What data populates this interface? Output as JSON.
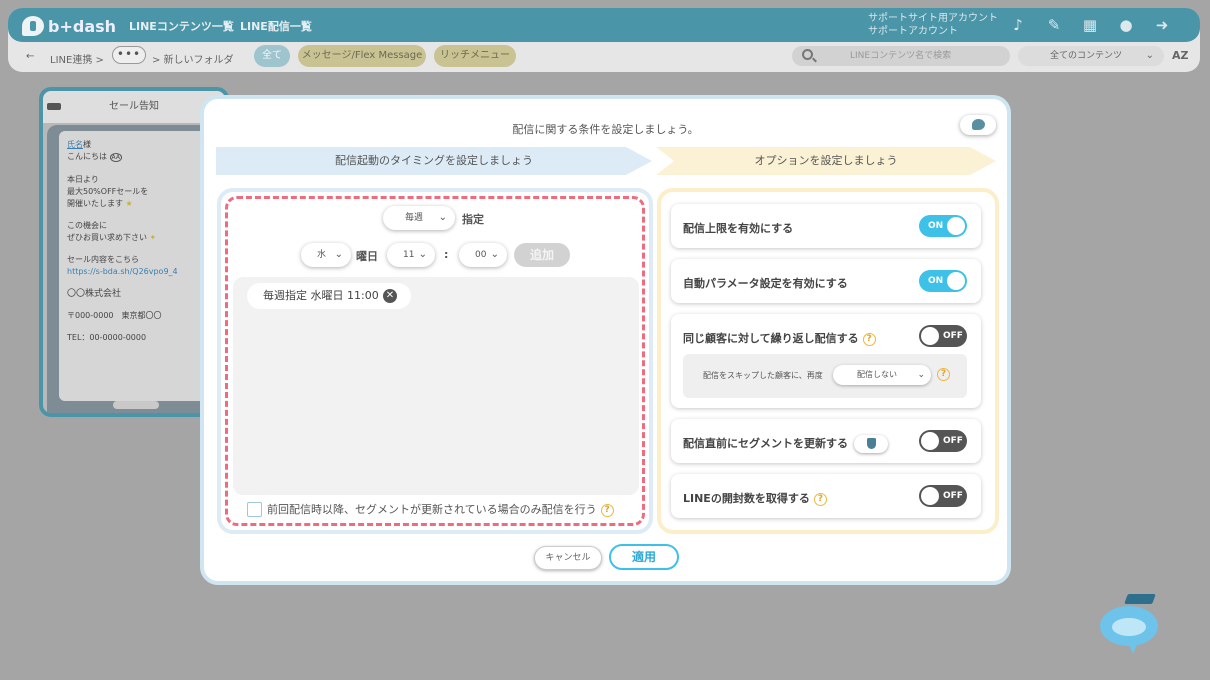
{
  "header": {
    "logo_text": "b+dash",
    "nav": [
      "LINEコンテンツ一覧",
      "LINE配信一覧"
    ],
    "support_lines": [
      "サポートサイト用アカウント",
      "サポートアカウント"
    ],
    "icons": [
      "bell-icon",
      "wrench-icon",
      "grid-icon",
      "chat-icon",
      "logout-icon"
    ]
  },
  "subbar": {
    "back": "←",
    "breadcrumb_root": "LINE連携 >",
    "breadcrumb_more": "•••",
    "breadcrumb_leaf": "> 新しいフォルダ",
    "filters": [
      "全て",
      "メッセージ/Flex Message",
      "リッチメニュー"
    ],
    "search_placeholder": "LINEコンテンツ名で検索",
    "content_select": "全てのコンテンツ",
    "sort_label": "AZ"
  },
  "preview": {
    "title": "セール告知",
    "lines": {
      "name": "氏名",
      "name_suffix": "様",
      "greeting": "こんにちは",
      "greeting_badge": "AA",
      "p2_1": "本日より",
      "p2_2": "最大50%OFFセールを",
      "p2_3": "開催いたします",
      "p3_1": "この機会に",
      "p3_2": "ぜひお買い求め下さい",
      "p4_1": "セール内容をこちら",
      "url": "https://s-bda.sh/Q26vpo9_4",
      "company": "〇〇株式会社",
      "address": "〒000-0000　東京都〇〇",
      "tel": "TEL：00-0000-0000"
    }
  },
  "modal": {
    "title": "配信に関する条件を設定しましょう。",
    "step1": "配信起動のタイミングを設定しましょう",
    "step2": "オプションを設定しましょう",
    "timing": {
      "frequency": "毎週",
      "frequency_suffix": "指定",
      "weekday": "水",
      "weekday_suffix": "曜日",
      "hour": "11",
      "colon": ":",
      "minute": "00",
      "add_label": "追加",
      "schedule_chip": "毎週指定 水曜日 11:00",
      "remove_glyph": "✕",
      "checkbox_label": "前回配信時以降、セグメントが更新されている場合のみ配信を行う"
    },
    "options": [
      {
        "label": "配信上限を有効にする",
        "state": "ON"
      },
      {
        "label": "自動パラメータ設定を有効にする",
        "state": "ON"
      },
      {
        "label": "同じ顧客に対して繰り返し配信する",
        "state": "OFF"
      },
      {
        "label": "配信直前にセグメントを更新する",
        "state": "OFF"
      },
      {
        "label": "LINEの開封数を取得する",
        "state": "OFF"
      }
    ],
    "repeat_sub": {
      "text": "配信をスキップした顧客に、再度",
      "select": "配信しない"
    },
    "help_glyph": "?",
    "cancel_label": "キャンセル",
    "apply_label": "適用"
  },
  "colors": {
    "accent": "#3ec1e8",
    "dashed_border": "#ef6c7f",
    "toggle_off": "#555555",
    "step1_bg": "#dcebf5",
    "step2_bg": "#fbf1d4"
  }
}
